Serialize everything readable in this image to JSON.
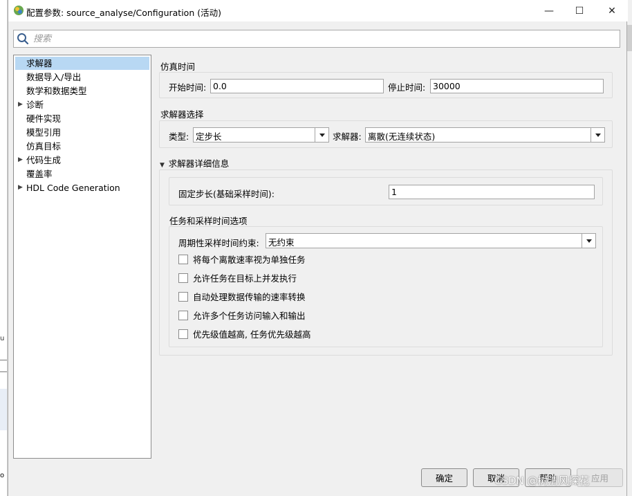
{
  "background_app": {
    "marks": [
      "u",
      "o"
    ]
  },
  "window": {
    "title": "配置参数: source_analyse/Configuration (活动)",
    "controls": {
      "minimize": "—",
      "maximize": "☐",
      "close": "✕"
    }
  },
  "search": {
    "placeholder": "搜索",
    "value": ""
  },
  "tree": {
    "items": [
      {
        "label": "求解器",
        "selected": true,
        "expandable": false
      },
      {
        "label": "数据导入/导出",
        "selected": false,
        "expandable": false
      },
      {
        "label": "数学和数据类型",
        "selected": false,
        "expandable": false
      },
      {
        "label": "诊断",
        "selected": false,
        "expandable": true
      },
      {
        "label": "硬件实现",
        "selected": false,
        "expandable": false
      },
      {
        "label": "模型引用",
        "selected": false,
        "expandable": false
      },
      {
        "label": "仿真目标",
        "selected": false,
        "expandable": false
      },
      {
        "label": "代码生成",
        "selected": false,
        "expandable": true
      },
      {
        "label": "覆盖率",
        "selected": false,
        "expandable": false
      },
      {
        "label": "HDL Code Generation",
        "selected": false,
        "expandable": true
      }
    ]
  },
  "sim_time": {
    "title": "仿真时间",
    "start_label": "开始时间:",
    "start_value": "0.0",
    "stop_label": "停止时间:",
    "stop_value": "30000"
  },
  "solver_select": {
    "title": "求解器选择",
    "type_label": "类型:",
    "type_value": "定步长",
    "solver_label": "求解器:",
    "solver_value": "离散(无连续状态)"
  },
  "solver_details": {
    "title": "求解器详细信息",
    "step_label": "固定步长(基础采样时间):",
    "step_value": "1"
  },
  "tasks": {
    "title": "任务和采样时间选项",
    "periodic_label": "周期性采样时间约束:",
    "periodic_value": "无约束",
    "checkboxes": [
      {
        "label": "将每个离散速率视为单独任务",
        "checked": false
      },
      {
        "label": "允许任务在目标上并发执行",
        "checked": false
      },
      {
        "label": "自动处理数据传输的速率转换",
        "checked": false
      },
      {
        "label": "允许多个任务访问输入和输出",
        "checked": false
      },
      {
        "label": "优先级值越高, 任务优先级越高",
        "checked": false
      }
    ]
  },
  "buttons": {
    "ok": "确定",
    "cancel": "取消",
    "help": "帮助",
    "apply": "应用"
  },
  "watermark": "CSDN @树清风探花",
  "colors": {
    "selection": "#b8d8f3",
    "window_bg": "#f0f0f0"
  }
}
